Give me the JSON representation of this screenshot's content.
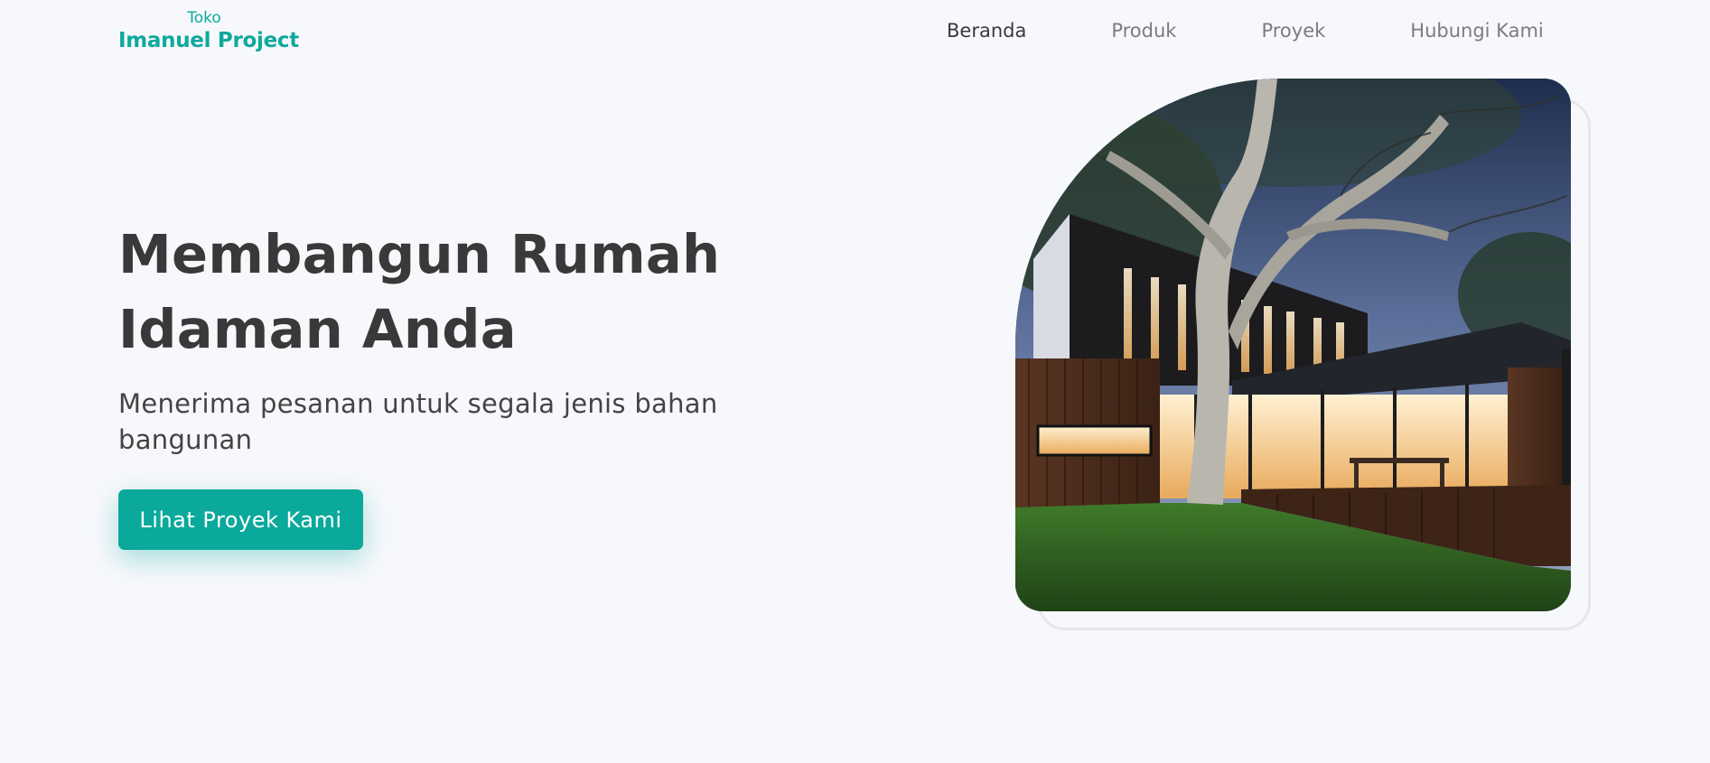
{
  "brand": {
    "small_label": "Toko",
    "name": "Imanuel Project",
    "color": "#0da99c"
  },
  "nav": {
    "items": [
      {
        "label": "Beranda",
        "active": true
      },
      {
        "label": "Produk",
        "active": false
      },
      {
        "label": "Proyek",
        "active": false
      },
      {
        "label": "Hubungi Kami",
        "active": false
      }
    ]
  },
  "hero": {
    "title_line1": "Membangun Rumah",
    "title_line2": "Idaman Anda",
    "subtitle": "Menerima pesanan untuk segala jenis bahan bangunan",
    "cta_label": "Lihat Proyek Kami",
    "image_alt": "Modern house with large tree at dusk"
  },
  "colors": {
    "accent": "#0aa99b",
    "background": "#f7f8fc",
    "heading": "#393939",
    "nav_inactive": "#7c7c7c"
  }
}
